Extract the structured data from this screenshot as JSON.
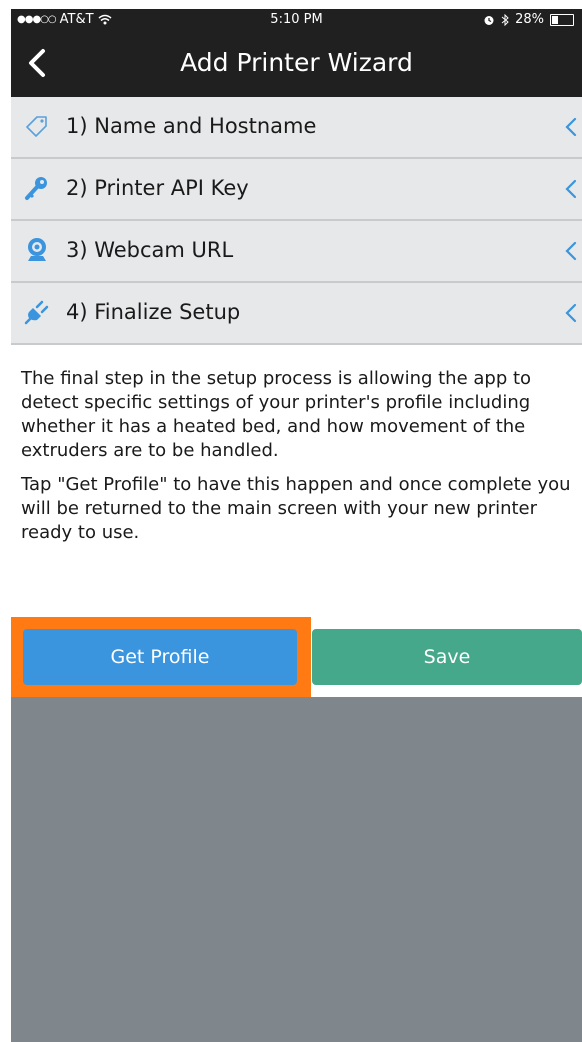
{
  "status_bar": {
    "signal": "●●●○○",
    "carrier": "AT&T",
    "wifi": "wifi-icon",
    "time": "5:10 PM",
    "alarm": "alarm-icon",
    "bluetooth": "bluetooth-icon",
    "battery_label": "28%",
    "battery_level": 0.28
  },
  "header": {
    "title": "Add Printer Wizard",
    "back": "back-chevron-icon"
  },
  "steps": [
    {
      "label": "1) Name and Hostname",
      "icon": "tag-icon"
    },
    {
      "label": "2) Printer API Key",
      "icon": "key-icon"
    },
    {
      "label": "3) Webcam URL",
      "icon": "webcam-icon"
    },
    {
      "label": "4) Finalize Setup",
      "icon": "plug-icon"
    }
  ],
  "body": {
    "paragraph1": "The final step in the setup process is allowing the app to detect specific settings of your printer's profile including whether it has a heated bed, and how movement of the extruders are to be handled.",
    "paragraph2": "Tap \"Get Profile\" to have this happen and once complete you will be returned to the main screen with your new printer ready to use."
  },
  "buttons": {
    "get_profile": "Get Profile",
    "save": "Save"
  },
  "colors": {
    "accent_blue": "#3a95de",
    "save_green": "#46a88a",
    "highlight_orange": "#ff7a12",
    "header_bg": "#202020",
    "step_bg": "#e7e8ea"
  }
}
